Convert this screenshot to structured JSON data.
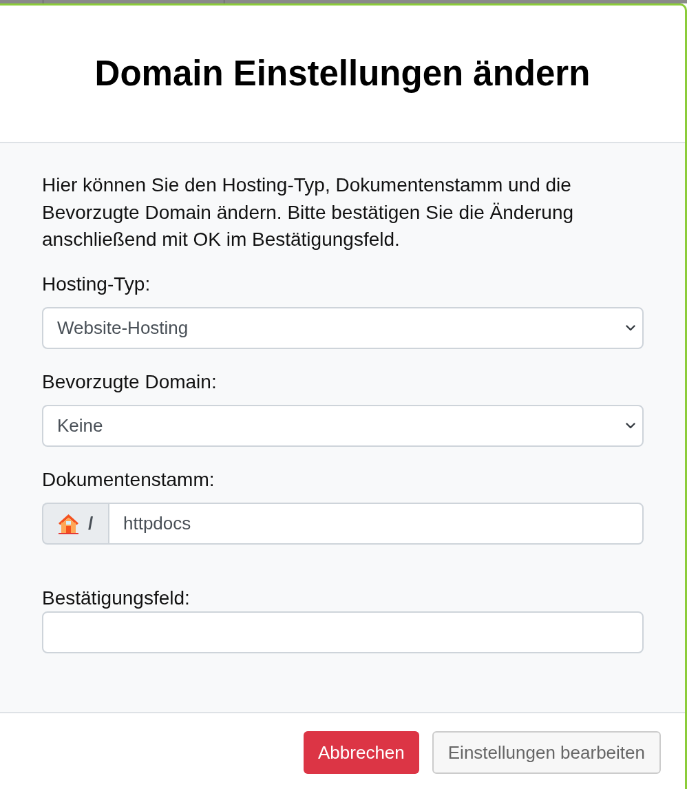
{
  "dialog": {
    "title": "Domain Einstellungen ändern"
  },
  "intro": "Hier können Sie den Hosting-Typ, Dokumentenstamm und die Bevorzugte Domain ändern. Bitte bestätigen Sie die Änderung anschließend mit OK im Bestätigungsfeld.",
  "fields": [
    {
      "kind": "select",
      "label": "Hosting-Typ:",
      "value": "Website-Hosting"
    },
    {
      "kind": "select",
      "label": "Bevorzugte Domain:",
      "value": "Keine"
    },
    {
      "kind": "prefixed",
      "label": "Dokumentenstamm:",
      "prefix": "/",
      "value": "httpdocs"
    },
    {
      "kind": "text",
      "label": "Bestätigungsfeld:"
    }
  ],
  "buttons": [
    {
      "label": "Abbrechen",
      "kind": "danger"
    },
    {
      "label": "Einstellungen bearbeiten",
      "kind": "secondary"
    }
  ]
}
